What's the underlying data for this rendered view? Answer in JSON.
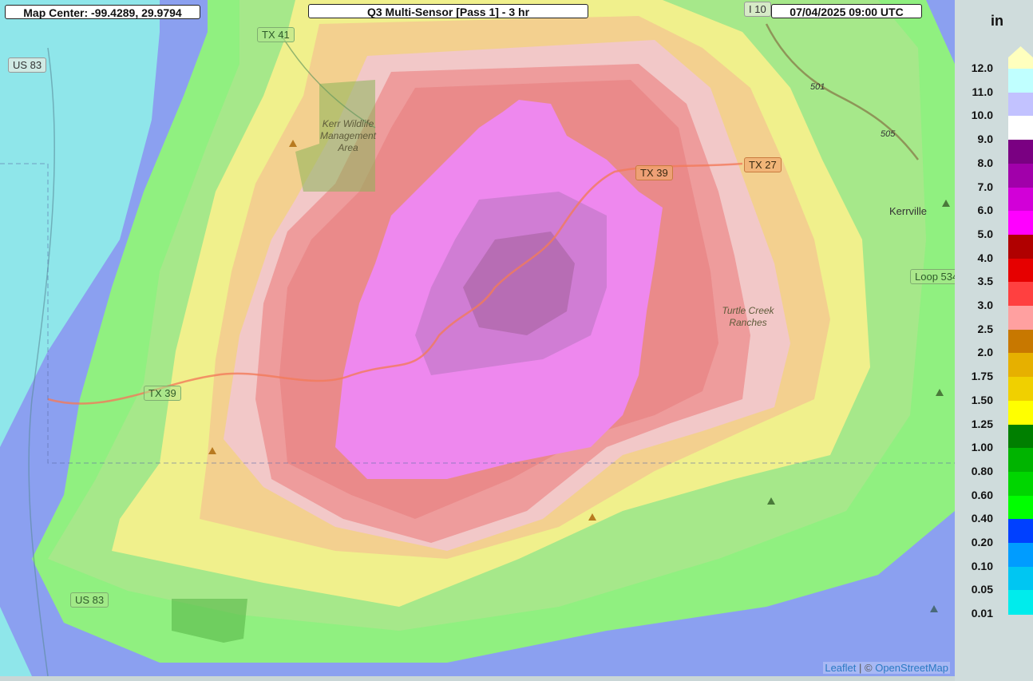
{
  "header": {
    "map_center": "Map Center: -99.4289, 29.9794",
    "product_title": "Q3 Multi-Sensor [Pass 1] - 3 hr",
    "timestamp": "07/04/2025   09:00 UTC"
  },
  "map": {
    "road_labels": [
      "US 83",
      "TX 41",
      "TX 39",
      "TX 39",
      "TX 27",
      "I 10",
      "Loop 534",
      "US 83"
    ],
    "route_numbers": [
      "501",
      "505"
    ],
    "places": [
      "Kerr Wildlife Management Area",
      "Turtle Creek Ranches",
      "Kerrville"
    ],
    "attribution_leaflet": "Leaflet",
    "attribution_separator": "| ©",
    "attribution_osm": "OpenStreetMap"
  },
  "legend": {
    "unit": "in",
    "labels": [
      "12.0",
      "11.0",
      "10.0",
      "9.0",
      "8.0",
      "7.0",
      "6.0",
      "5.0",
      "4.0",
      "3.5",
      "3.0",
      "2.5",
      "2.0",
      "1.75",
      "1.50",
      "1.25",
      "1.00",
      "0.80",
      "0.60",
      "0.40",
      "0.20",
      "0.10",
      "0.05",
      "0.01"
    ],
    "colors": [
      "#c0ffff",
      "#c2c2ff",
      "#ffffff",
      "#7a0082",
      "#a100aa",
      "#d200d8",
      "#ff00ff",
      "#b00000",
      "#e60000",
      "#ff4040",
      "#ffa0a0",
      "#c87800",
      "#e6b000",
      "#f0d000",
      "#ffff00",
      "#007f00",
      "#00b400",
      "#00d600",
      "#00ff00",
      "#0040ff",
      "#009cff",
      "#00c6f2",
      "#00ecec"
    ],
    "overflow_color": "#ffffbe"
  },
  "precip_field": {
    "description_levels": [
      "0.20",
      "0.40",
      "0.60",
      "1.00",
      "1.25",
      "1.50",
      "2.0",
      "2.5",
      "3.0",
      "5.0"
    ],
    "contour_colors": [
      "#8ba0f0",
      "#90f080",
      "#a6e88a",
      "#f0f08c",
      "#f3d08f",
      "#f2c8c8",
      "#ee9c9c",
      "#ea8a8a",
      "#ee88ee"
    ]
  }
}
